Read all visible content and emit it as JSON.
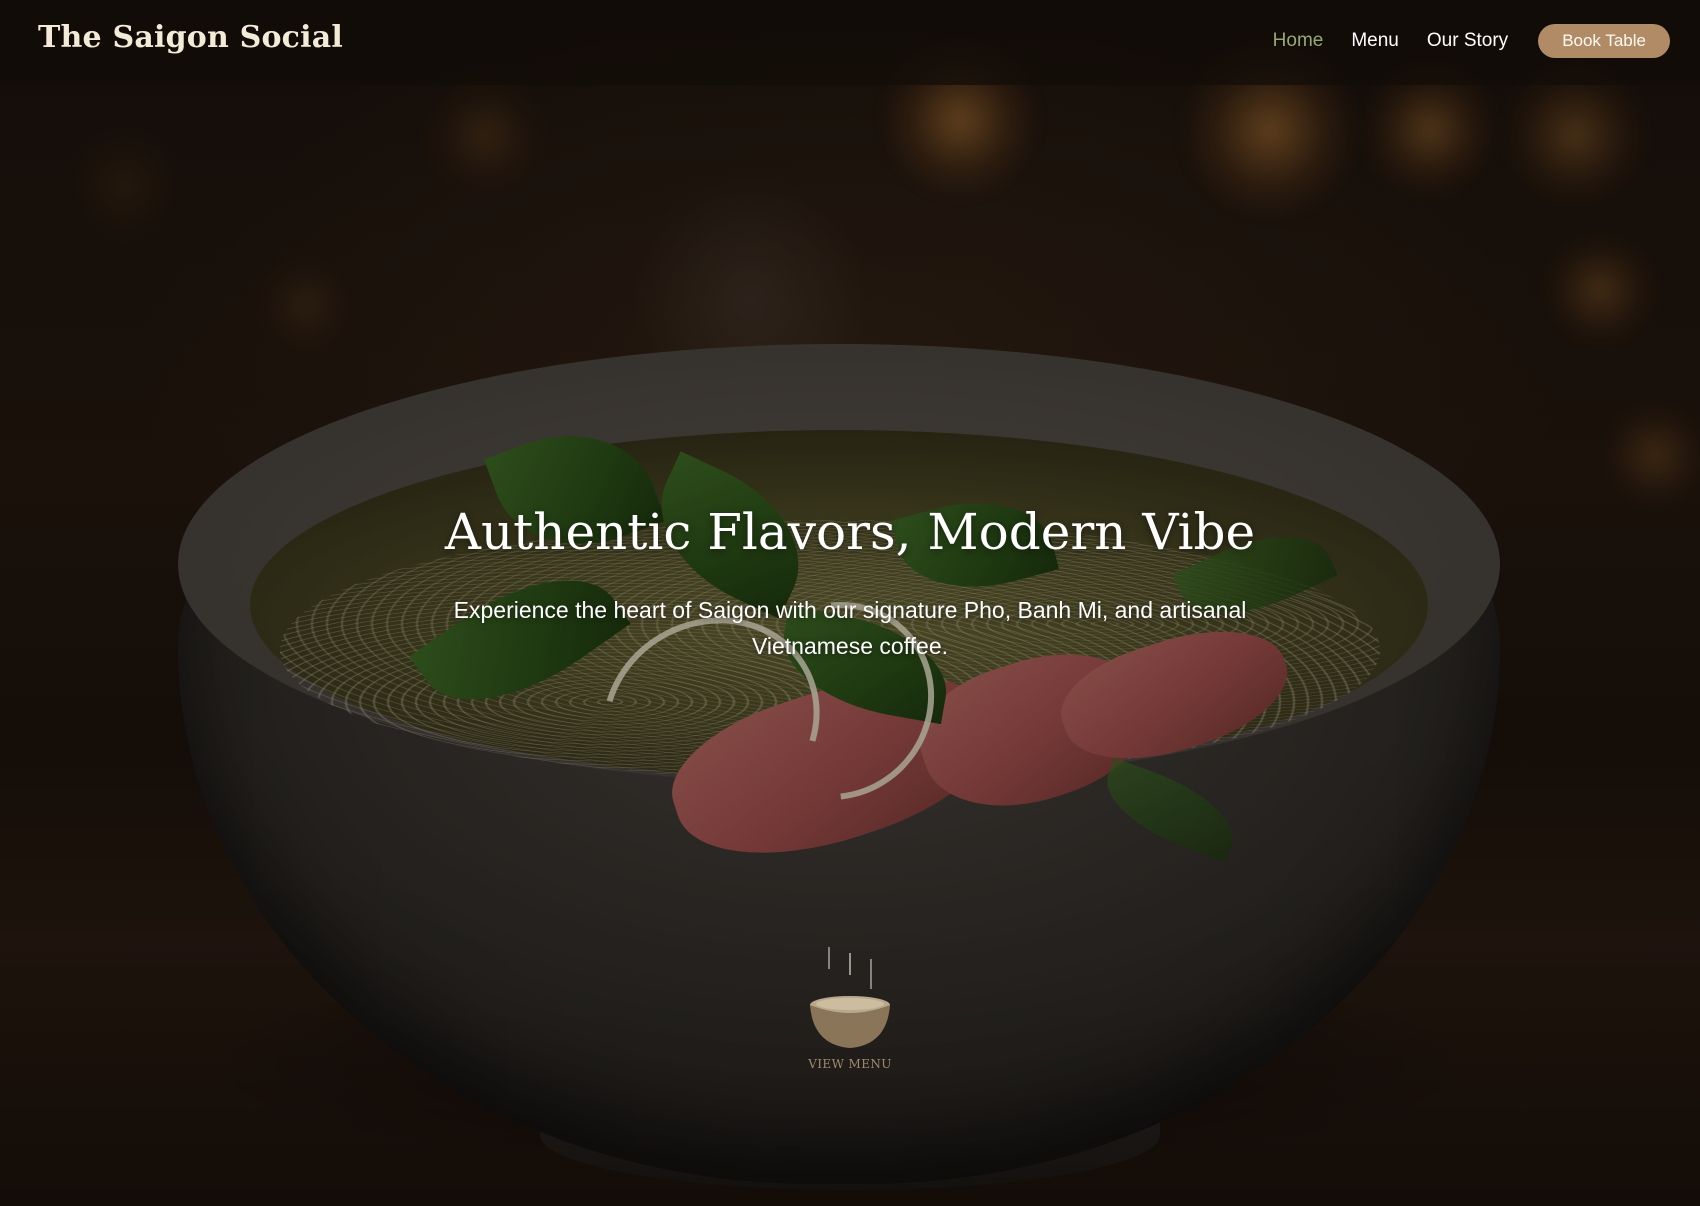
{
  "header": {
    "brand": "The Saigon Social",
    "nav": [
      {
        "label": "Home",
        "active": true
      },
      {
        "label": "Menu",
        "active": false
      },
      {
        "label": "Our Story",
        "active": false
      }
    ],
    "cta_label": "Book Table"
  },
  "hero": {
    "title": "Authentic Flavors, Modern Vibe",
    "subtitle": "Experience the heart of Saigon with our signature Pho, Banh Mi, and artisanal Vietnamese coffee.",
    "scroll_cta": {
      "label": "VIEW MENU",
      "icon": "pho-bowl-icon"
    },
    "background_image": "steaming bowl of pho with rare beef, noodles and fresh herbs on dark wooden table"
  },
  "colors": {
    "accent": "#b08b66",
    "nav_active": "#98a872",
    "text_light": "#ffffff",
    "brand_text": "#f3ead8"
  }
}
